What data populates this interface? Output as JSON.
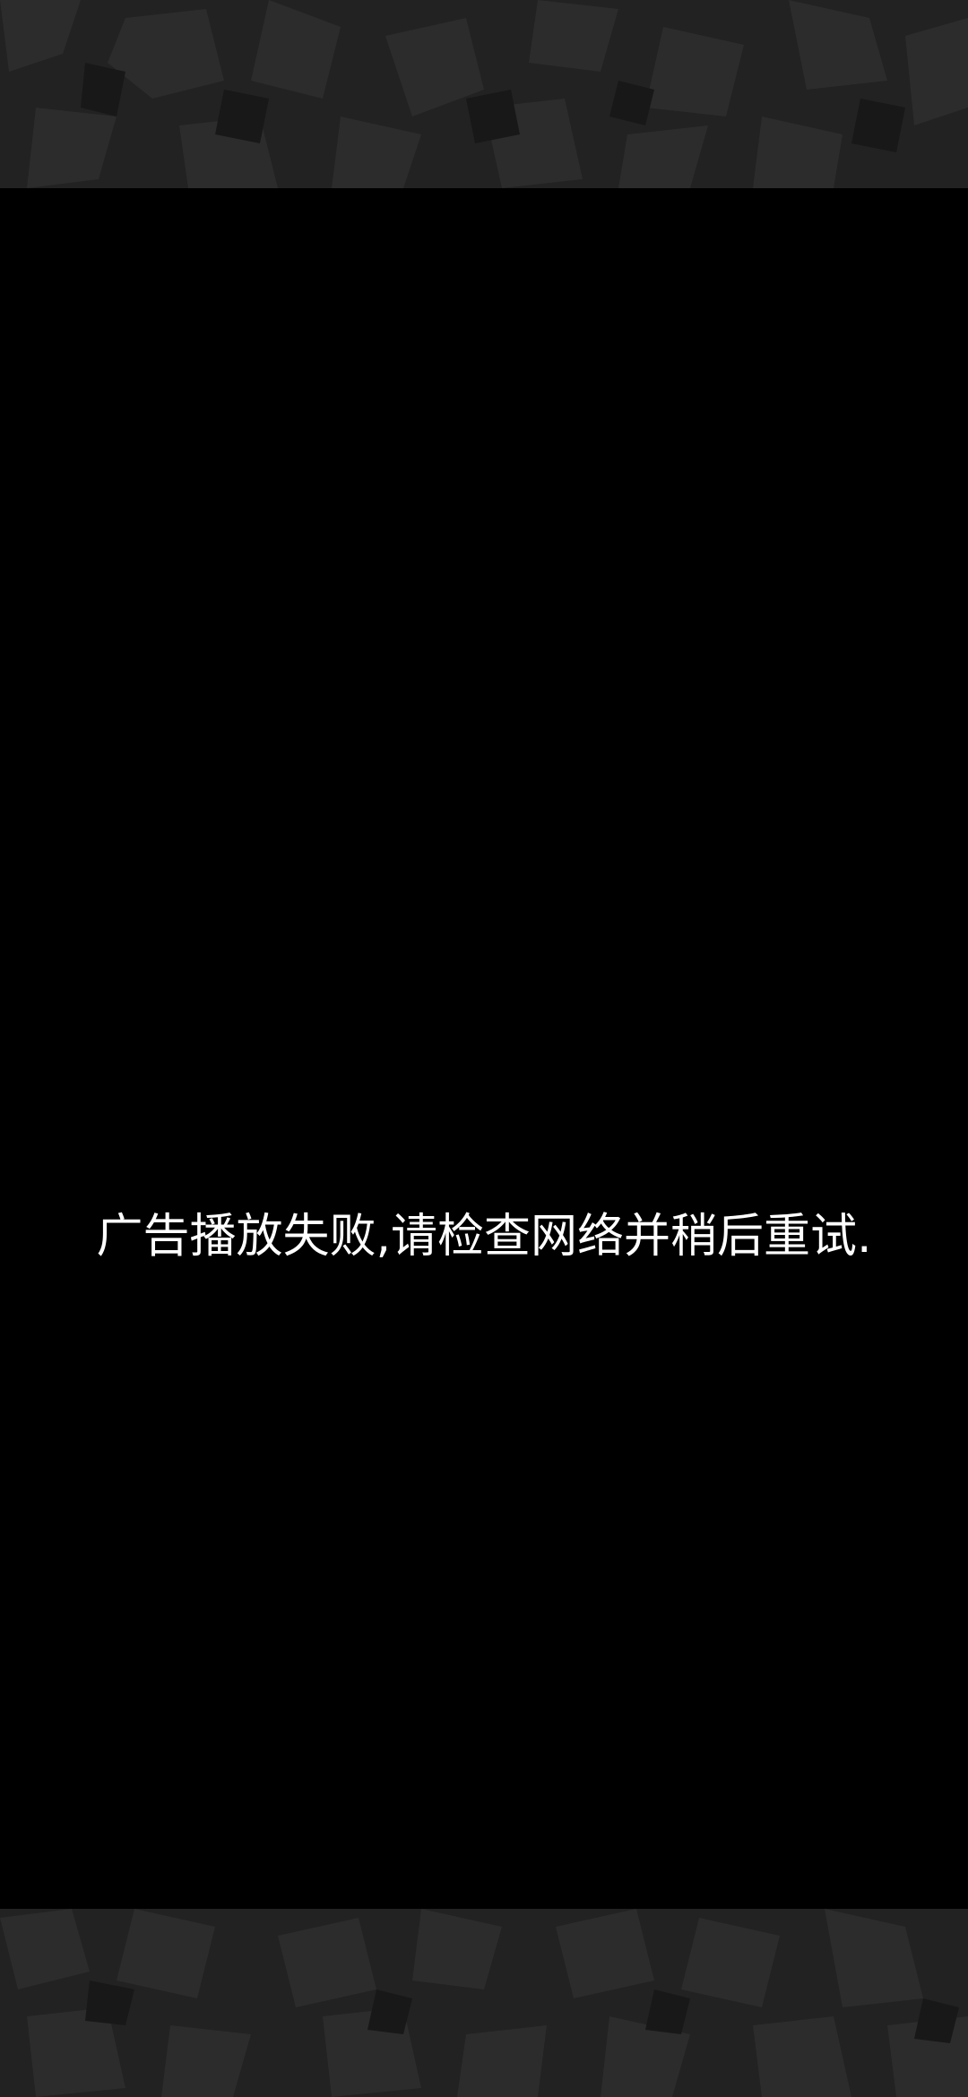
{
  "ad": {
    "error_message": "广告播放失败,请检查网络并稍后重试."
  },
  "colors": {
    "panel_background": "#000000",
    "backdrop": "#202020",
    "text": "#ffffff"
  },
  "icons": {
    "backdrop_texture": "stone-texture"
  }
}
